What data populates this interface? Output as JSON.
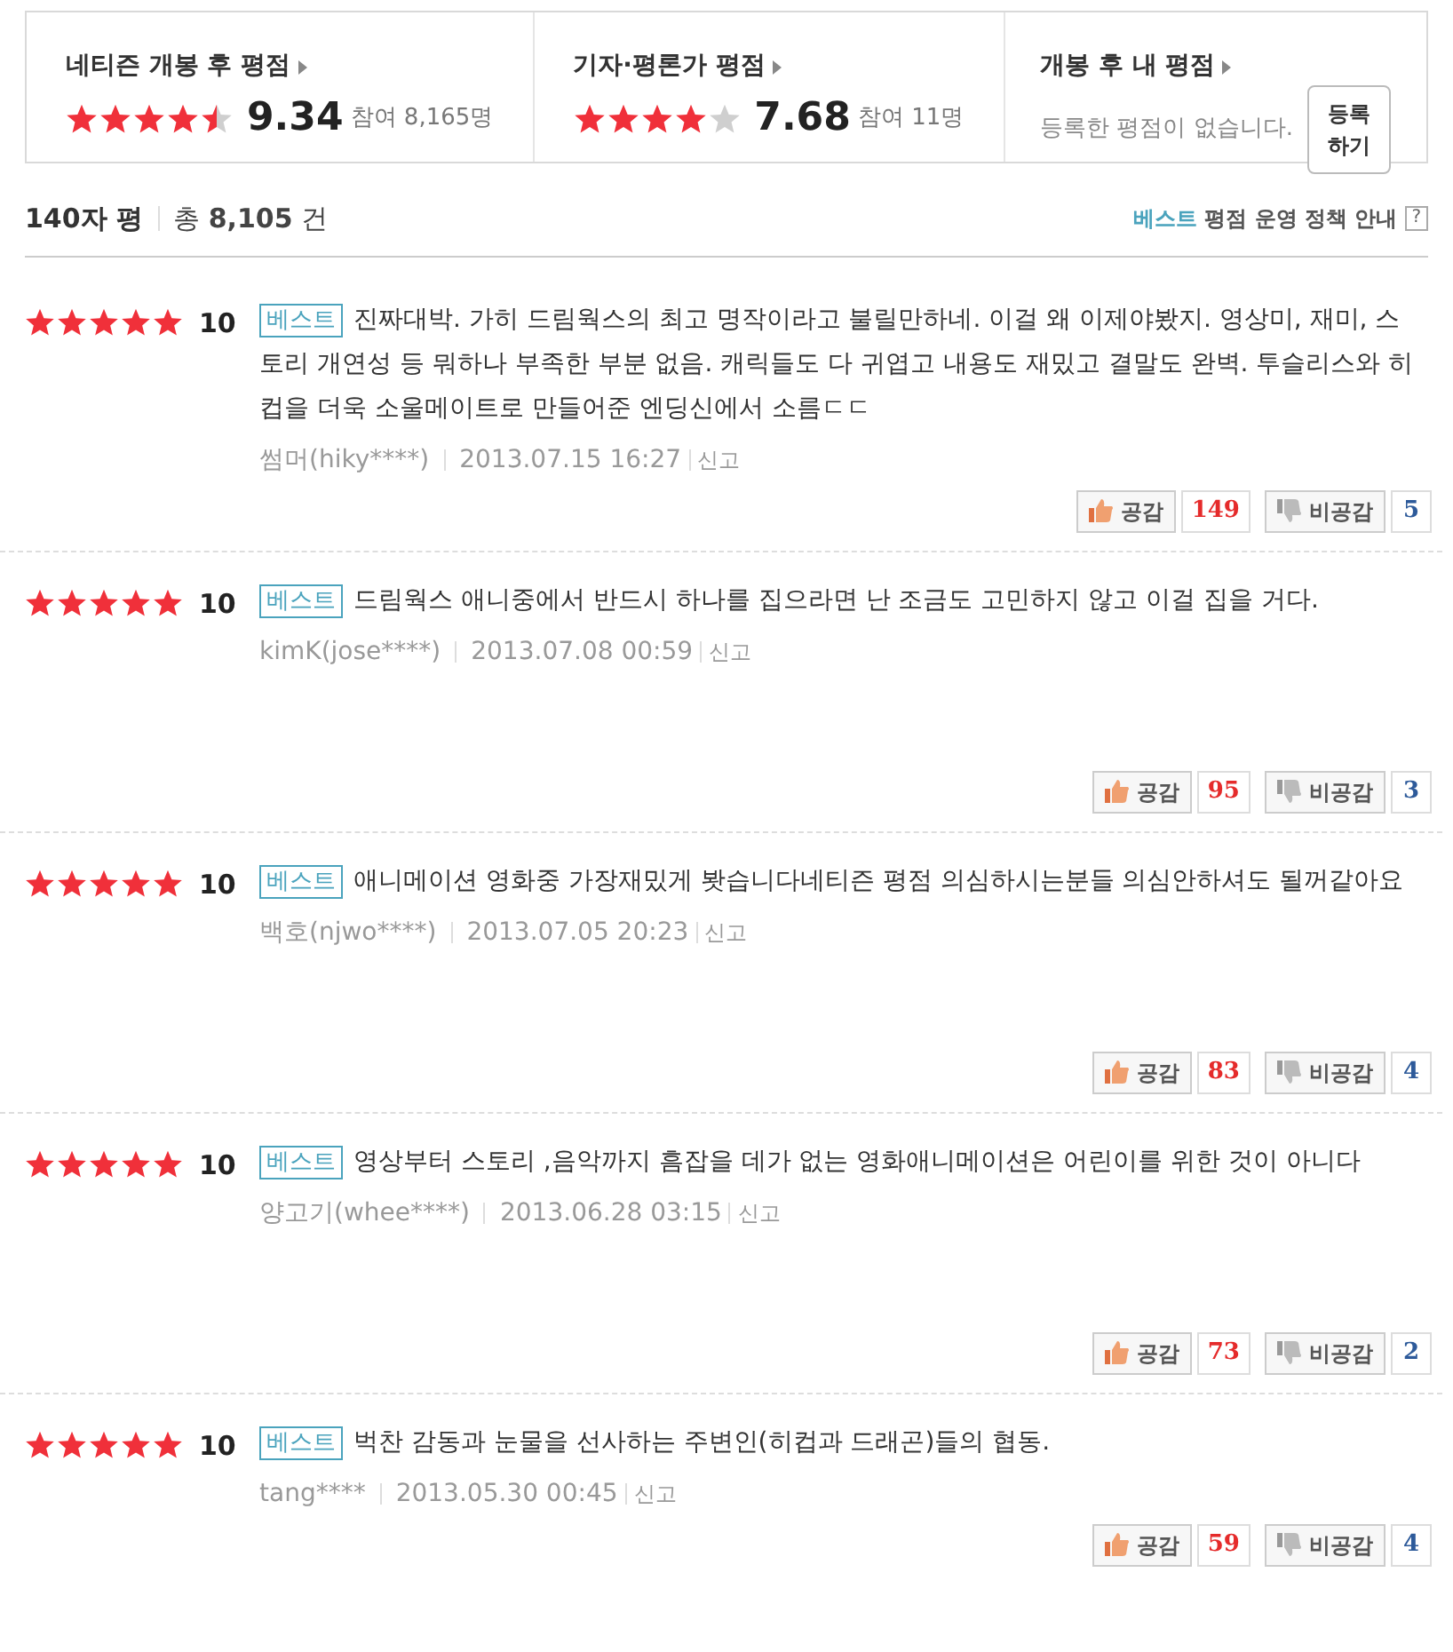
{
  "summary": [
    {
      "kind": "rating",
      "title": "네티즌 개봉 후 평점",
      "stars": 4.5,
      "score": "9.34",
      "count_label": "참여",
      "count": "8,165명"
    },
    {
      "kind": "rating",
      "title": "기자·평론가 평점",
      "stars": 4,
      "score": "7.68",
      "count_label": "참여",
      "count": "11명"
    },
    {
      "kind": "mine",
      "title": "개봉 후 내 평점",
      "message": "등록한 평점이 없습니다.",
      "button": "등록하기"
    }
  ],
  "header": {
    "title": "140자 평",
    "total_label": "총",
    "total": "8,105",
    "unit": "건",
    "policy_best": "베스트",
    "policy_rest": "평점 운영 정책 안내",
    "help": "?"
  },
  "reviews": [
    {
      "stars": 5,
      "score": "10",
      "badge": "베스트",
      "text": "진짜대박. 가히 드림웍스의 최고 명작이라고 불릴만하네. 이걸 왜 이제야봤지. 영상미, 재미, 스토리 개연성 등 뭐하나 부족한 부분 없음. 캐릭들도 다 귀엽고 내용도 재밌고 결말도 완벽. 투슬리스와 히컵을 더욱 소울메이트로 만들어준 엔딩신에서 소름ㄷㄷ",
      "author": "썸머(hiky****)",
      "date": "2013.07.15 16:27",
      "report": "신고",
      "like": "공감",
      "likes": "149",
      "dislike": "비공감",
      "dislikes": "5"
    },
    {
      "stars": 5,
      "score": "10",
      "badge": "베스트",
      "text": "드림웍스 애니중에서 반드시 하나를 집으라면 난 조금도 고민하지 않고 이걸 집을 거다.",
      "author": "kimK(jose****)",
      "date": "2013.07.08 00:59",
      "report": "신고",
      "like": "공감",
      "likes": "95",
      "dislike": "비공감",
      "dislikes": "3"
    },
    {
      "stars": 5,
      "score": "10",
      "badge": "베스트",
      "text": "애니메이션 영화중 가장재밌게 봣습니다네티즌 평점 의심하시는분들 의심안하셔도 될꺼같아요",
      "author": "백호(njwo****)",
      "date": "2013.07.05 20:23",
      "report": "신고",
      "like": "공감",
      "likes": "83",
      "dislike": "비공감",
      "dislikes": "4"
    },
    {
      "stars": 5,
      "score": "10",
      "badge": "베스트",
      "text": "영상부터 스토리 ,음악까지 흠잡을 데가 없는 영화애니메이션은 어린이를 위한 것이 아니다",
      "author": "양고기(whee****)",
      "date": "2013.06.28 03:15",
      "report": "신고",
      "like": "공감",
      "likes": "73",
      "dislike": "비공감",
      "dislikes": "2"
    },
    {
      "stars": 5,
      "score": "10",
      "badge": "베스트",
      "text": "벅찬 감동과 눈물을 선사하는 주변인(히컵과 드래곤)들의 협동.",
      "author": "tang****",
      "date": "2013.05.30 00:45",
      "report": "신고",
      "like": "공감",
      "likes": "59",
      "dislike": "비공감",
      "dislikes": "4"
    }
  ]
}
